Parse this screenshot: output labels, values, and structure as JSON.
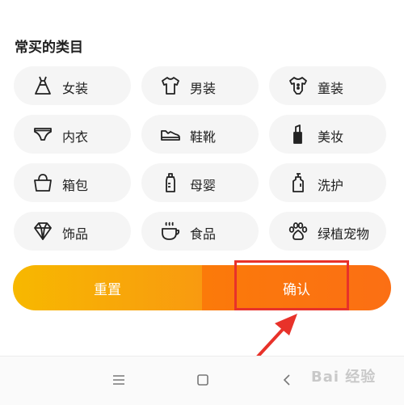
{
  "section": {
    "title": "常买的类目"
  },
  "categories": [
    {
      "label": "女装",
      "icon": "dress-icon"
    },
    {
      "label": "男装",
      "icon": "tshirt-icon"
    },
    {
      "label": "童装",
      "icon": "baby-clothes-icon"
    },
    {
      "label": "内衣",
      "icon": "underwear-icon"
    },
    {
      "label": "鞋靴",
      "icon": "shoe-icon"
    },
    {
      "label": "美妆",
      "icon": "lipstick-icon"
    },
    {
      "label": "箱包",
      "icon": "handbag-icon"
    },
    {
      "label": "母婴",
      "icon": "baby-bottle-icon"
    },
    {
      "label": "洗护",
      "icon": "lotion-bottle-icon"
    },
    {
      "label": "饰品",
      "icon": "diamond-icon"
    },
    {
      "label": "食品",
      "icon": "cup-icon"
    },
    {
      "label": "绿植宠物",
      "icon": "paw-icon"
    }
  ],
  "actions": {
    "reset_label": "重置",
    "confirm_label": "确认"
  },
  "navbar": {
    "menu_icon": "menu-icon",
    "home_icon": "home-square-icon",
    "back_icon": "back-chevron-icon"
  },
  "watermark": {
    "text": "Bai 经验"
  },
  "colors": {
    "chip_bg": "#f5f5f5",
    "reset_start": "#f7b800",
    "confirm": "#fb7a0a",
    "highlight": "#e8322a"
  }
}
